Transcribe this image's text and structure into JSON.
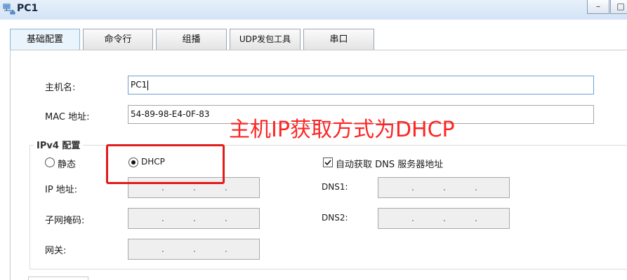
{
  "window": {
    "title": "PC1",
    "minimize_glyph": "–",
    "restore_glyph": "□"
  },
  "tabs": [
    {
      "label": "基础配置",
      "active": true
    },
    {
      "label": "命令行",
      "active": false
    },
    {
      "label": "组播",
      "active": false
    },
    {
      "label": "UDP发包工具",
      "active": false
    },
    {
      "label": "串口",
      "active": false
    }
  ],
  "host": {
    "hostname_label": "主机名:",
    "hostname_value": "PC1",
    "mac_label": "MAC 地址:",
    "mac_value": "54-89-98-E4-0F-83"
  },
  "ipv4": {
    "legend": "IPv4 配置",
    "static_label": "静态",
    "dhcp_label": "DHCP",
    "selected_mode": "DHCP",
    "auto_dns_label": "自动获取 DNS 服务器地址",
    "auto_dns_checked": true,
    "ip_label": "IP 地址:",
    "mask_label": "子网掩码:",
    "gateway_label": "网关:",
    "dns1_label": "DNS1:",
    "dns2_label": "DNS2:",
    "ip_separator": "."
  },
  "annotation": {
    "text": "主机IP获取方式为DHCP",
    "color": "#ff2424"
  },
  "colors": {
    "titlebar": "#d3e3f6",
    "active_tab": "#eaf4fc",
    "disabled_field": "#efefef",
    "annotation_red": "#e21b1b"
  }
}
